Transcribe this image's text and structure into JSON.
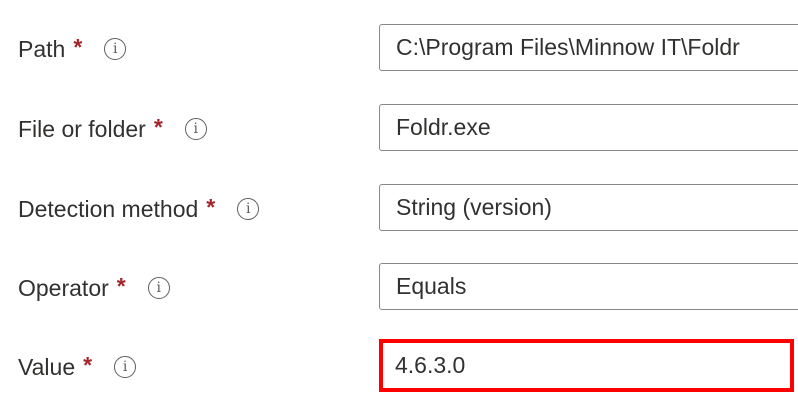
{
  "form": {
    "rows": [
      {
        "label": "Path",
        "required": "*",
        "info": "i",
        "value": "C:\\Program Files\\Minnow IT\\Foldr"
      },
      {
        "label": "File or folder",
        "required": "*",
        "info": "i",
        "value": "Foldr.exe"
      },
      {
        "label": "Detection method",
        "required": "*",
        "info": "i",
        "value": "String (version)"
      },
      {
        "label": "Operator",
        "required": "*",
        "info": "i",
        "value": "Equals"
      },
      {
        "label": "Value",
        "required": "*",
        "info": "i",
        "value": "4.6.3.0"
      }
    ]
  },
  "colors": {
    "required_star": "#a4262c",
    "highlight_border": "#ff0000",
    "field_border": "#8a8886",
    "text": "#323130"
  }
}
